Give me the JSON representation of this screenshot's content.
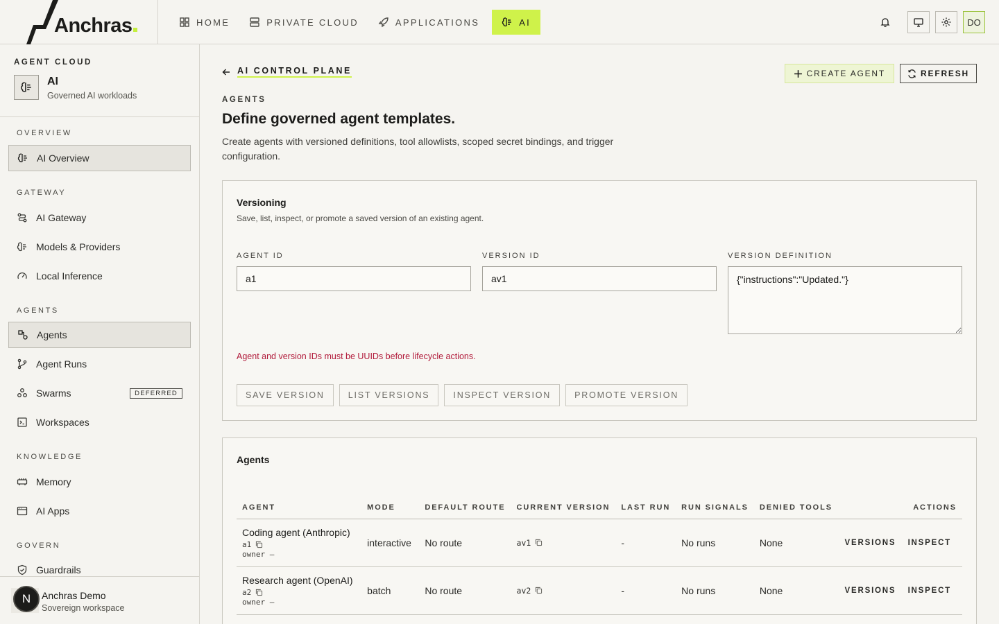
{
  "brand": {
    "name": "Anchras"
  },
  "nav": [
    {
      "label": "HOME",
      "icon": "grid-icon"
    },
    {
      "label": "PRIVATE CLOUD",
      "icon": "server-icon"
    },
    {
      "label": "APPLICATIONS",
      "icon": "rocket-icon"
    },
    {
      "label": "AI",
      "icon": "brain-icon",
      "active": true
    }
  ],
  "user": {
    "initials": "DO"
  },
  "colors": {
    "accent": "#cff24a",
    "error": "#b11a3a"
  },
  "sidebar": {
    "eyebrow": "AGENT CLOUD",
    "app_title": "AI",
    "app_sub": "Governed AI workloads",
    "sections": {
      "overview": "OVERVIEW",
      "gateway": "GATEWAY",
      "agents": "AGENTS",
      "knowledge": "KNOWLEDGE",
      "govern": "GOVERN"
    },
    "items": {
      "ai_overview": "AI Overview",
      "ai_gateway": "AI Gateway",
      "models": "Models & Providers",
      "local_inference": "Local Inference",
      "agents": "Agents",
      "agent_runs": "Agent Runs",
      "swarms": "Swarms",
      "swarms_badge": "DEFERRED",
      "workspaces": "Workspaces",
      "memory": "Memory",
      "ai_apps": "AI Apps",
      "guardrails": "Guardrails"
    },
    "footer": {
      "avatar_letter": "N",
      "name": "Anchras Demo",
      "sub": "Sovereign workspace"
    }
  },
  "main": {
    "back_label": "AI CONTROL PLANE",
    "create_label": "CREATE AGENT",
    "refresh_label": "REFRESH",
    "eyebrow": "AGENTS",
    "title": "Define governed agent templates.",
    "lead": "Create agents with versioned definitions, tool allowlists, scoped secret bindings, and trigger configuration."
  },
  "versioning": {
    "title": "Versioning",
    "sub": "Save, list, inspect, or promote a saved version of an existing agent.",
    "agent_id_label": "AGENT ID",
    "agent_id_value": "a1",
    "version_id_label": "VERSION ID",
    "version_id_value": "av1",
    "definition_label": "VERSION DEFINITION",
    "definition_value": "{\"instructions\":\"Updated.\"}",
    "error": "Agent and version IDs must be UUIDs before lifecycle actions.",
    "buttons": [
      "SAVE VERSION",
      "LIST VERSIONS",
      "INSPECT VERSION",
      "PROMOTE VERSION"
    ]
  },
  "agents_table": {
    "title": "Agents",
    "columns": [
      "AGENT",
      "MODE",
      "DEFAULT ROUTE",
      "CURRENT VERSION",
      "LAST RUN",
      "RUN SIGNALS",
      "DENIED TOOLS",
      "ACTIONS"
    ],
    "rows": [
      {
        "name": "Coding agent (Anthropic)",
        "id": "a1",
        "owner": "owner –",
        "mode": "interactive",
        "route": "No route",
        "version": "av1",
        "last_run": "-",
        "signals": "No runs",
        "denied": "None",
        "action1": "VERSIONS",
        "action2": "INSPECT"
      },
      {
        "name": "Research agent (OpenAI)",
        "id": "a2",
        "owner": "owner –",
        "mode": "batch",
        "route": "No route",
        "version": "av2",
        "last_run": "-",
        "signals": "No runs",
        "denied": "None",
        "action1": "VERSIONS",
        "action2": "INSPECT"
      }
    ]
  }
}
